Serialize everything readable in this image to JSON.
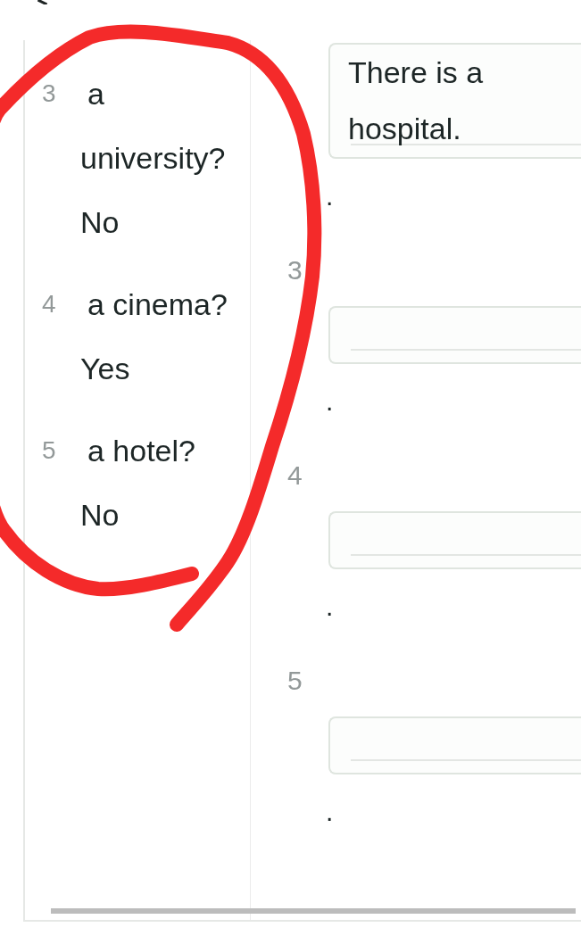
{
  "question_list": {
    "items": [
      {
        "number": "3",
        "question": "a university?",
        "answer": "No"
      },
      {
        "number": "4",
        "question": "a cinema?",
        "answer": "Yes"
      },
      {
        "number": "5",
        "question": "a hotel?",
        "answer": "No"
      }
    ]
  },
  "answer_list": {
    "items": [
      {
        "value": "There is a hospital.",
        "end_mark": "."
      },
      {
        "number": "3",
        "end_mark": "."
      },
      {
        "number": "4",
        "end_mark": "."
      },
      {
        "number": "5",
        "end_mark": "."
      }
    ]
  }
}
